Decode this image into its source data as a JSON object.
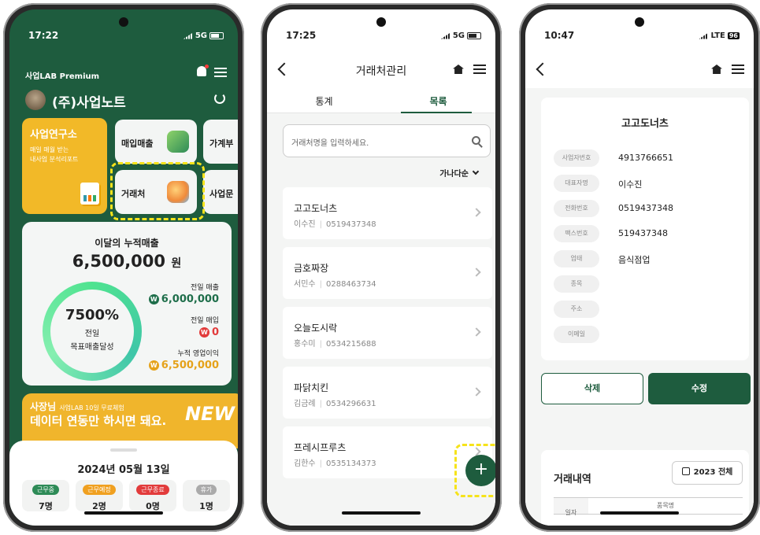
{
  "screen1": {
    "status": {
      "time": "17:22",
      "network": "5G"
    },
    "brand": "사업LAB Premium",
    "company": "(주)사업노트",
    "tiles": {
      "research": {
        "title": "사업연구소",
        "sub1": "매일 매월 받는",
        "sub2": "내사업 분석리포트"
      },
      "sales_in": "매입매출",
      "household": "가계부",
      "partners": "거래처",
      "business": "사업문"
    },
    "sales": {
      "title": "이달의 누적매출",
      "amount": "6,500,000",
      "unit": "원",
      "progress_pct": "7500%",
      "progress_l1": "전일",
      "progress_l2": "목표매출달성",
      "prev_sales_label": "전일 매출",
      "prev_sales_value": "6,000,000",
      "prev_buy_label": "전일 매입",
      "prev_buy_value": "0",
      "profit_label": "누적 영업이익",
      "profit_value": "6,500,000",
      "coin_symbol": "W"
    },
    "banner": {
      "l1a": "사장님",
      "l1b": "사업LAB 10일 무료체험",
      "l2": "데이터 연동만 하시면 돼요.",
      "new": "NEW"
    },
    "sheet": {
      "date": "2024년 05월 13일",
      "statuses": [
        {
          "label": "근무중",
          "count": "7명",
          "color": "#2e8b57"
        },
        {
          "label": "근무예정",
          "count": "2명",
          "color": "#f0a020"
        },
        {
          "label": "근무종료",
          "count": "0명",
          "color": "#e23b3b"
        },
        {
          "label": "휴가",
          "count": "1명",
          "color": "#aaaaaa"
        }
      ]
    }
  },
  "screen2": {
    "status": {
      "time": "17:25",
      "network": "5G"
    },
    "title": "거래처관리",
    "tabs": [
      "통계",
      "목록"
    ],
    "search_placeholder": "거래처명을 입력하세요.",
    "sort": "가나다순",
    "items": [
      {
        "name": "고고도너츠",
        "person": "이수진",
        "phone": "0519437348"
      },
      {
        "name": "금호짜장",
        "person": "서민수",
        "phone": "0288463734"
      },
      {
        "name": "오늘도시락",
        "person": "홍수미",
        "phone": "0534215688"
      },
      {
        "name": "파닭치킨",
        "person": "김금례",
        "phone": "0534296631"
      },
      {
        "name": "프레시프루츠",
        "person": "김한수",
        "phone": "0535134373"
      }
    ],
    "fab": "+"
  },
  "screen3": {
    "status": {
      "time": "10:47",
      "network": "LTE",
      "battery": "96"
    },
    "name": "고고도너츠",
    "fields": [
      {
        "label": "사업자번호",
        "value": "4913766651"
      },
      {
        "label": "대표자명",
        "value": "이수진"
      },
      {
        "label": "전화번호",
        "value": "0519437348"
      },
      {
        "label": "팩스번호",
        "value": "519437348"
      },
      {
        "label": "업태",
        "value": "음식점업"
      },
      {
        "label": "종목",
        "value": ""
      },
      {
        "label": "주소",
        "value": ""
      },
      {
        "label": "이메일",
        "value": ""
      }
    ],
    "delete": "삭제",
    "edit": "수정",
    "history_title": "거래내역",
    "year_filter": "2023 전체",
    "col_date": "일자",
    "col_item": "품목명"
  }
}
